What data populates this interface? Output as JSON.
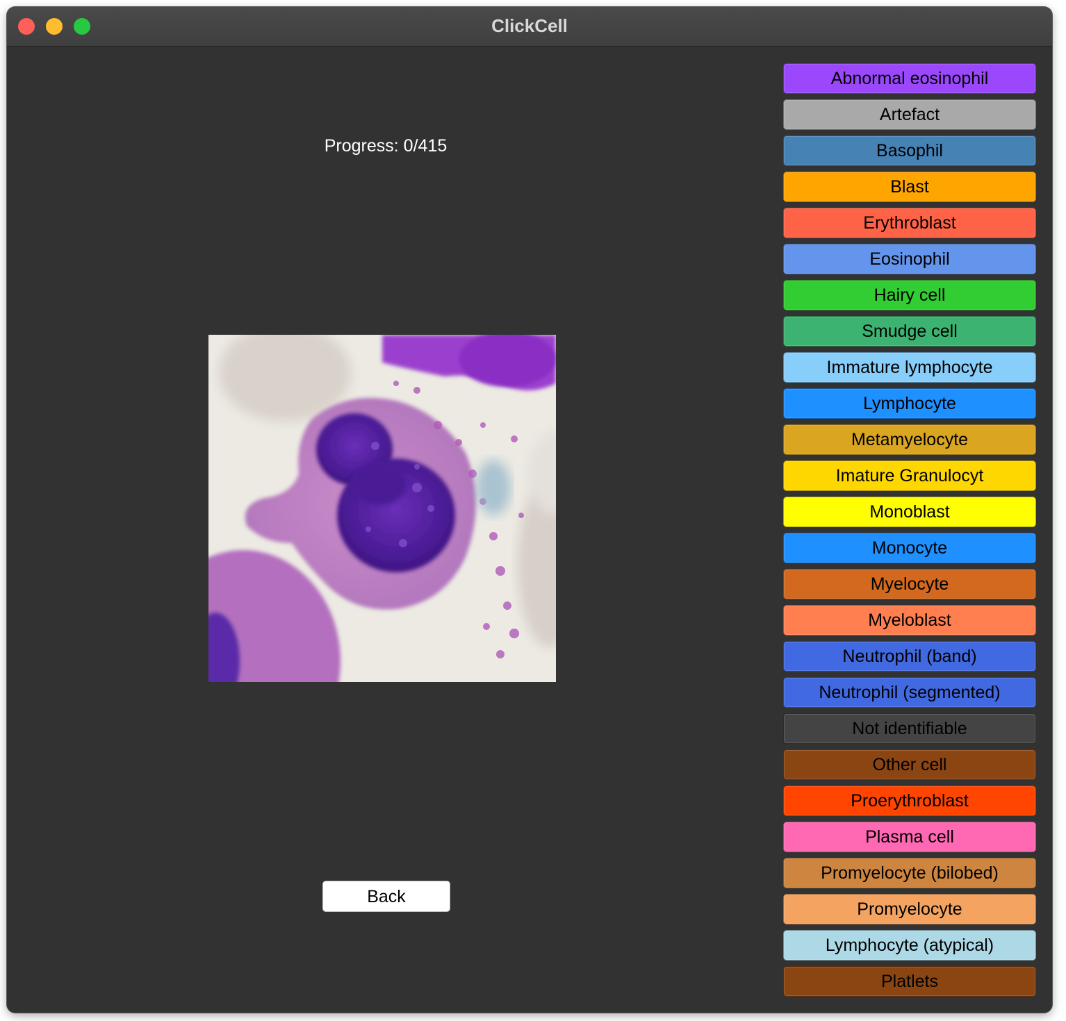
{
  "window": {
    "title": "ClickCell"
  },
  "progress": {
    "text": "Progress: 0/415"
  },
  "back_button": {
    "label": "Back"
  },
  "cell_types": [
    {
      "label": "Abnormal eosinophil",
      "color": "#9b48fc"
    },
    {
      "label": "Artefact",
      "color": "#a9a9a9"
    },
    {
      "label": "Basophil",
      "color": "#4682b4"
    },
    {
      "label": "Blast",
      "color": "#ffa500"
    },
    {
      "label": "Erythroblast",
      "color": "#ff6347"
    },
    {
      "label": "Eosinophil",
      "color": "#6495ed"
    },
    {
      "label": "Hairy cell",
      "color": "#32cd32"
    },
    {
      "label": "Smudge cell",
      "color": "#3cb371"
    },
    {
      "label": "Immature lymphocyte",
      "color": "#87cefa"
    },
    {
      "label": "Lymphocyte",
      "color": "#1e90ff"
    },
    {
      "label": "Metamyelocyte",
      "color": "#daa520"
    },
    {
      "label": "Imature Granulocyt",
      "color": "#ffd700"
    },
    {
      "label": "Monoblast",
      "color": "#ffff00"
    },
    {
      "label": "Monocyte",
      "color": "#1e90ff"
    },
    {
      "label": "Myelocyte",
      "color": "#d2691e"
    },
    {
      "label": "Myeloblast",
      "color": "#ff7f50"
    },
    {
      "label": "Neutrophil (band)",
      "color": "#4169e1"
    },
    {
      "label": "Neutrophil (segmented)",
      "color": "#4169e1"
    },
    {
      "label": "Not identifiable",
      "color": "#444444"
    },
    {
      "label": "Other cell",
      "color": "#8b4513"
    },
    {
      "label": "Proerythroblast",
      "color": "#ff4500"
    },
    {
      "label": "Plasma cell",
      "color": "#ff69b4"
    },
    {
      "label": "Promyelocyte (bilobed)",
      "color": "#cd853f"
    },
    {
      "label": "Promyelocyte",
      "color": "#f4a460"
    },
    {
      "label": "Lymphocyte (atypical)",
      "color": "#add8e6"
    },
    {
      "label": "Platlets",
      "color": "#8b4513"
    }
  ]
}
